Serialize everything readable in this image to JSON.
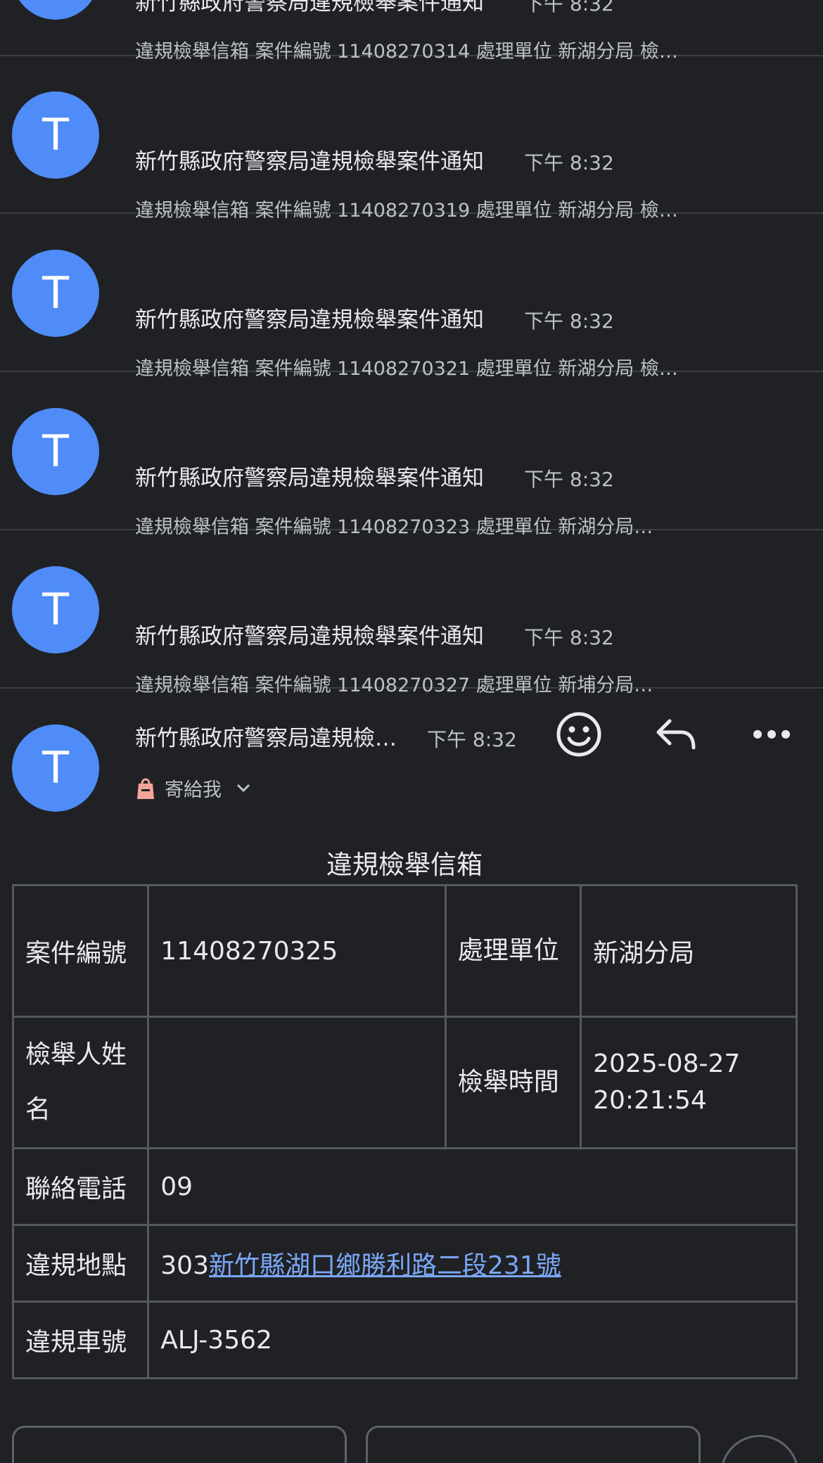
{
  "list": {
    "items": [
      {
        "avatar": "T",
        "sender": "新竹縣政府警察局違規檢舉案件通知",
        "time": "下午 8:32",
        "snippet": "違規檢舉信箱 案件編號 11408270314 處理單位 新湖分局 檢…"
      },
      {
        "avatar": "T",
        "sender": "新竹縣政府警察局違規檢舉案件通知",
        "time": "下午 8:32",
        "snippet": "違規檢舉信箱 案件編號 11408270319 處理單位 新湖分局 檢…"
      },
      {
        "avatar": "T",
        "sender": "新竹縣政府警察局違規檢舉案件通知",
        "time": "下午 8:32",
        "snippet": "違規檢舉信箱 案件編號 11408270321 處理單位 新湖分局 檢…"
      },
      {
        "avatar": "T",
        "sender": "新竹縣政府警察局違規檢舉案件通知",
        "time": "下午 8:32",
        "snippet": "違規檢舉信箱 案件編號 11408270323 處理單位 新湖分局…"
      },
      {
        "avatar": "T",
        "sender": "新竹縣政府警察局違規檢舉案件通知",
        "time": "下午 8:32",
        "snippet": "違規檢舉信箱 案件編號 11408270327 處理單位 新埔分局…"
      }
    ]
  },
  "open_message": {
    "avatar": "T",
    "sender": "新竹縣政府警察局違規檢舉案件通知",
    "time": "下午 8:32",
    "recipient": "寄給我",
    "icons": {
      "emoji": "emoji-icon",
      "reply": "reply-icon",
      "more": "more-icon",
      "label": "label-icon",
      "chevron": "chevron-down-icon"
    }
  },
  "report": {
    "title": "違規檢舉信箱",
    "case_no_label": "案件編號",
    "case_no": "11408270325",
    "unit_label": "處理單位",
    "unit": "新湖分局",
    "reporter_label": "檢舉人姓名",
    "reporter": "",
    "report_time_label": "檢舉時間",
    "report_date": "2025-08-27",
    "report_clock": "20:21:54",
    "phone_label": "聯絡電話",
    "phone": "09",
    "location_label": "違規地點",
    "location_zip": "303",
    "location_address": "新竹縣湖口鄉勝利路二段231號",
    "plate_label": "違規車號",
    "plate": "ALJ-3562"
  },
  "colors": {
    "background": "#202124",
    "avatar": "#4f8cf7",
    "link": "#7aa7f7",
    "divider": "#3c4043"
  }
}
